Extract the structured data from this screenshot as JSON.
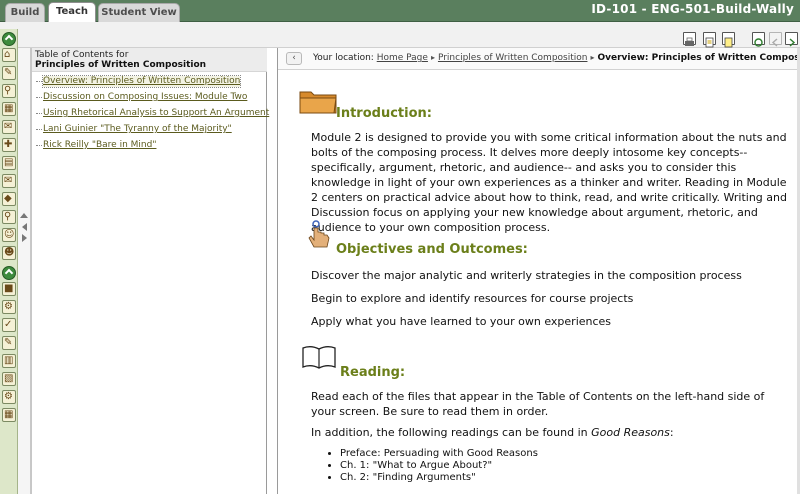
{
  "top_tabs": {
    "build": "Build",
    "teach": "Teach",
    "student_view": "Student View"
  },
  "course_title": "ID-101 - ENG-501-Build-Wally",
  "toc": {
    "caption": "Table of Contents for",
    "title": "Principles of Written Composition",
    "items": [
      "Overview: Principles of Written Composition",
      "Discussion on Composing Issues: Module Two",
      "Using Rhetorical Analysis to Support An Argument",
      "Lani Guinier \"The Tyranny of the Majority\"",
      "Rick Reilly \"Bare in Mind\""
    ]
  },
  "breadcrumb": {
    "back_label": "‹",
    "prefix": "Your location:",
    "home": "Home Page",
    "module": "Principles of Written Composition",
    "current": "Overview: Principles of Written Composition"
  },
  "introduction": {
    "heading": "Introduction:",
    "text": "Module 2 is designed to provide you with some critical information about the nuts and bolts of the composing process. It delves more deeply intosome key concepts-- specifically, argument, rhetoric, and audience-- and asks you to consider this knowledge in light of your own experiences as a thinker and writer. Reading in Module 2 centers on practical advice about how to think, read, and write critically. Writing and Discussion focus on applying your new knowledge about argument, rhetoric, and audience to your own composition process."
  },
  "objectives": {
    "heading": "Objectives and Outcomes:",
    "items": [
      "Discover the major analytic and writerly strategies in the composition process",
      "Begin to explore and identify resources for course projects",
      "Apply what you have learned to your own experiences"
    ]
  },
  "reading": {
    "heading": "Reading:",
    "text1": "Read each of the files that appear in the Table of Contents on the left-hand side of your screen. Be sure to read them in order.",
    "text2_prefix": "In addition, the following readings can be found in ",
    "text2_book": "Good Reasons",
    "text2_suffix": ":",
    "list": [
      "Preface: Persuading with Good Reasons",
      "Ch. 1: \"What to Argue About?\"",
      "Ch. 2: \"Finding Arguments\""
    ]
  }
}
